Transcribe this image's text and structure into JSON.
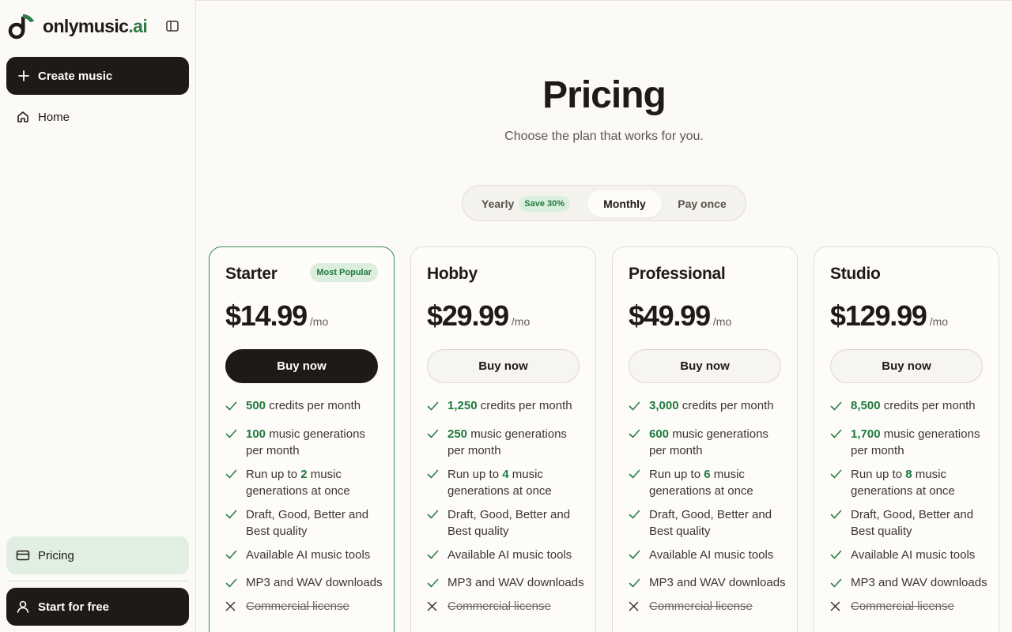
{
  "brand": {
    "name_main": "onlymusic",
    "name_suffix": ".ai",
    "accent": "#2f7b43"
  },
  "sidebar": {
    "create_label": "Create music",
    "home_label": "Home",
    "pricing_label": "Pricing",
    "start_label": "Start for free"
  },
  "header": {
    "title": "Pricing",
    "subtitle": "Choose the plan that works for you."
  },
  "billing_toggle": {
    "yearly_label": "Yearly",
    "yearly_badge": "Save 30%",
    "monthly_label": "Monthly",
    "once_label": "Pay once",
    "selected": "Monthly"
  },
  "plans": [
    {
      "name": "Starter",
      "badge": "Most Popular",
      "price": "$14.99",
      "period": "/mo",
      "cta": "Buy now",
      "credits": "500",
      "credits_text": " credits per month",
      "generations": "100",
      "generations_text": " music generations per month",
      "concurrent_pre": "Run up to ",
      "concurrent": "2",
      "concurrent_text": " music generations at once",
      "quality": "Draft, Good, Better and Best quality",
      "tools": "Available AI music tools",
      "downloads": "MP3 and WAV downloads",
      "license": "Commercial license"
    },
    {
      "name": "Hobby",
      "price": "$29.99",
      "period": "/mo",
      "cta": "Buy now",
      "credits": "1,250",
      "credits_text": " credits per month",
      "generations": "250",
      "generations_text": " music generations per month",
      "concurrent_pre": "Run up to ",
      "concurrent": "4",
      "concurrent_text": " music generations at once",
      "quality": "Draft, Good, Better and Best quality",
      "tools": "Available AI music tools",
      "downloads": "MP3 and WAV downloads",
      "license": "Commercial license"
    },
    {
      "name": "Professional",
      "price": "$49.99",
      "period": "/mo",
      "cta": "Buy now",
      "credits": "3,000",
      "credits_text": " credits per month",
      "generations": "600",
      "generations_text": " music generations per month",
      "concurrent_pre": "Run up to ",
      "concurrent": "6",
      "concurrent_text": " music generations at once",
      "quality": "Draft, Good, Better and Best quality",
      "tools": "Available AI music tools",
      "downloads": "MP3 and WAV downloads",
      "license": "Commercial license"
    },
    {
      "name": "Studio",
      "price": "$129.99",
      "period": "/mo",
      "cta": "Buy now",
      "credits": "8,500",
      "credits_text": " credits per month",
      "generations": "1,700",
      "generations_text": " music generations per month",
      "concurrent_pre": "Run up to ",
      "concurrent": "8",
      "concurrent_text": " music generations at once",
      "quality": "Draft, Good, Better and Best quality",
      "tools": "Available AI music tools",
      "downloads": "MP3 and WAV downloads",
      "license": "Commercial license"
    }
  ],
  "icons": {
    "logo": "music-note-logo-icon",
    "collapse": "sidebar-toggle-icon",
    "create": "plus-icon",
    "home": "home-icon",
    "pricing": "credit-card-icon",
    "start": "user-icon",
    "included": "check-icon",
    "excluded": "x-icon"
  }
}
